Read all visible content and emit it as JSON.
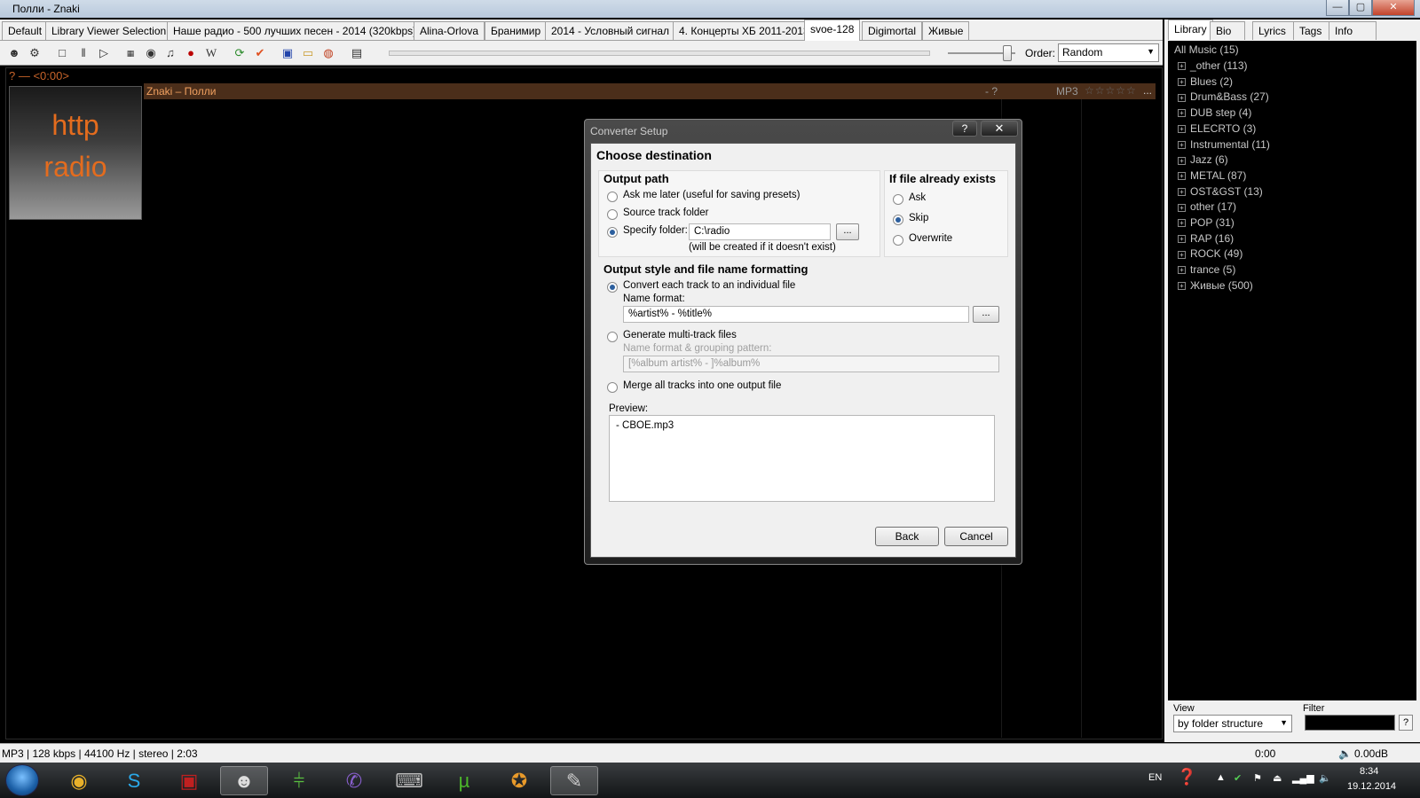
{
  "window": {
    "title": "Полли - Znaki",
    "min_glyph": "—",
    "max_glyph": "▢",
    "close_glyph": "✕"
  },
  "tabs": [
    "Default",
    "Library Viewer Selection",
    "Наше радио - 500 лучших песен - 2014 (320kbps)",
    "Alina-Orlova",
    "Бранимир",
    "2014 - Условный сигнал",
    "4. Концерты ХБ 2011-2013",
    "svoe-128",
    "Digimortal",
    "Живые"
  ],
  "active_tab": "svoe-128",
  "toolbar": {
    "icons": [
      "lastfm-icon",
      "settings-gear-icon",
      "stop-icon",
      "pause-icon",
      "play-icon",
      "freedb-icon",
      "cd-icon",
      "music-note-icon",
      "lastfm-red-icon",
      "wikipedia-icon",
      "refresh-icon",
      "checkmark-icon",
      "save-icon",
      "folder-open-icon",
      "globe-icon",
      "image-icon"
    ],
    "order_label": "Order:",
    "order_value": "Random"
  },
  "player": {
    "status": "? — <0:00>",
    "art_line1": "http",
    "art_line2": "radio",
    "now_playing": "Znaki – Полли",
    "duration": "- ?",
    "format": "MP3",
    "rating": "☆☆☆☆☆",
    "more": "..."
  },
  "right_panel": {
    "tabs": [
      "Library",
      "Bio",
      "Lyrics",
      "Tags",
      "Info"
    ],
    "active_tab": "Library",
    "tree_root": "All Music (15)",
    "tree_items": [
      "_other (113)",
      "Blues (2)",
      "Drum&Bass (27)",
      "DUB step (4)",
      "ELECRTO (3)",
      "Instrumental (11)",
      "Jazz (6)",
      "METAL (87)",
      "OST&GST (13)",
      "other (17)",
      "POP (31)",
      "RAP (16)",
      "ROCK (49)",
      "trance (5)",
      "Живые (500)"
    ],
    "expand_glyph": "+",
    "view_label": "View",
    "view_value": "by folder structure",
    "filter_label": "Filter",
    "filter_help": "?"
  },
  "statusbar": {
    "info": "MP3 | 128 kbps | 44100 Hz | stereo | 2:03",
    "time": "0:00",
    "volume": "0.00dB"
  },
  "dialog": {
    "title": "Converter Setup",
    "help": "?",
    "close": "✕",
    "heading": "Choose destination",
    "output_path": {
      "title": "Output path",
      "ask_later": "Ask me later (useful for saving presets)",
      "source_folder": "Source track folder",
      "specify_folder": "Specify folder:",
      "folder_value": "C:\\radio",
      "browse": "...",
      "note": "(will be created if it doesn't exist)",
      "selected": "specify_folder"
    },
    "if_exists": {
      "title": "If file already exists",
      "ask": "Ask",
      "skip": "Skip",
      "overwrite": "Overwrite",
      "selected": "skip"
    },
    "output_style": {
      "title": "Output style and file name formatting",
      "individual": "Convert each track to an individual file",
      "name_format_label": "Name format:",
      "name_format_value": "%artist% - %title%",
      "browse": "...",
      "multi_track": "Generate multi-track files",
      "grouping_label": "Name format & grouping pattern:",
      "grouping_value": "[%album artist% - ]%album%",
      "merge": "Merge all tracks into one output file",
      "selected": "individual"
    },
    "preview_label": "Preview:",
    "preview_value": "- CBOE.mp3",
    "back": "Back",
    "cancel": "Cancel"
  },
  "taskbar": {
    "apps": [
      "chrome-icon",
      "skype-icon",
      "media-player-icon",
      "foobar-icon",
      "network-icon",
      "viber-icon",
      "laptop-icon",
      "utorrent-icon",
      "game-icon",
      "paint-icon"
    ],
    "active_app": "foobar-icon",
    "lang": "EN",
    "clock_time": "8:34",
    "clock_date": "19.12.2014"
  }
}
